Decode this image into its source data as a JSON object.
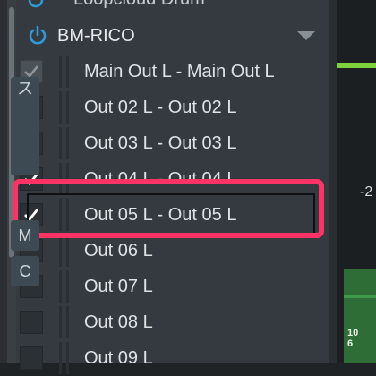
{
  "top_item": {
    "label": "Loopcloud Drum"
  },
  "device": {
    "name": "BM-RICO"
  },
  "outputs": [
    {
      "label": "Main Out L - Main Out L",
      "checked": true,
      "disabled": true
    },
    {
      "label": "Out 02 L - Out 02 L",
      "checked": true,
      "disabled": false
    },
    {
      "label": "Out 03 L - Out 03 L",
      "checked": true,
      "disabled": false
    },
    {
      "label": "Out 04 L - Out 04 L",
      "checked": true,
      "disabled": false
    },
    {
      "label": "Out 05 L - Out 05 L",
      "checked": true,
      "disabled": false
    },
    {
      "label": "Out 06 L",
      "checked": false,
      "disabled": false
    },
    {
      "label": "Out 07 L",
      "checked": false,
      "disabled": false
    },
    {
      "label": "Out 08 L",
      "checked": false,
      "disabled": false
    },
    {
      "label": "Out 09 L",
      "checked": false,
      "disabled": false
    }
  ],
  "right_panel": {
    "btn1": "ス",
    "value": "-2",
    "btn2": "M",
    "btn3": "C",
    "meter_top": "10",
    "meter_bottom": "6"
  },
  "colors": {
    "highlight": "#ff3366",
    "power": "#2f9bd6",
    "meter_green": "#7fd13b"
  }
}
